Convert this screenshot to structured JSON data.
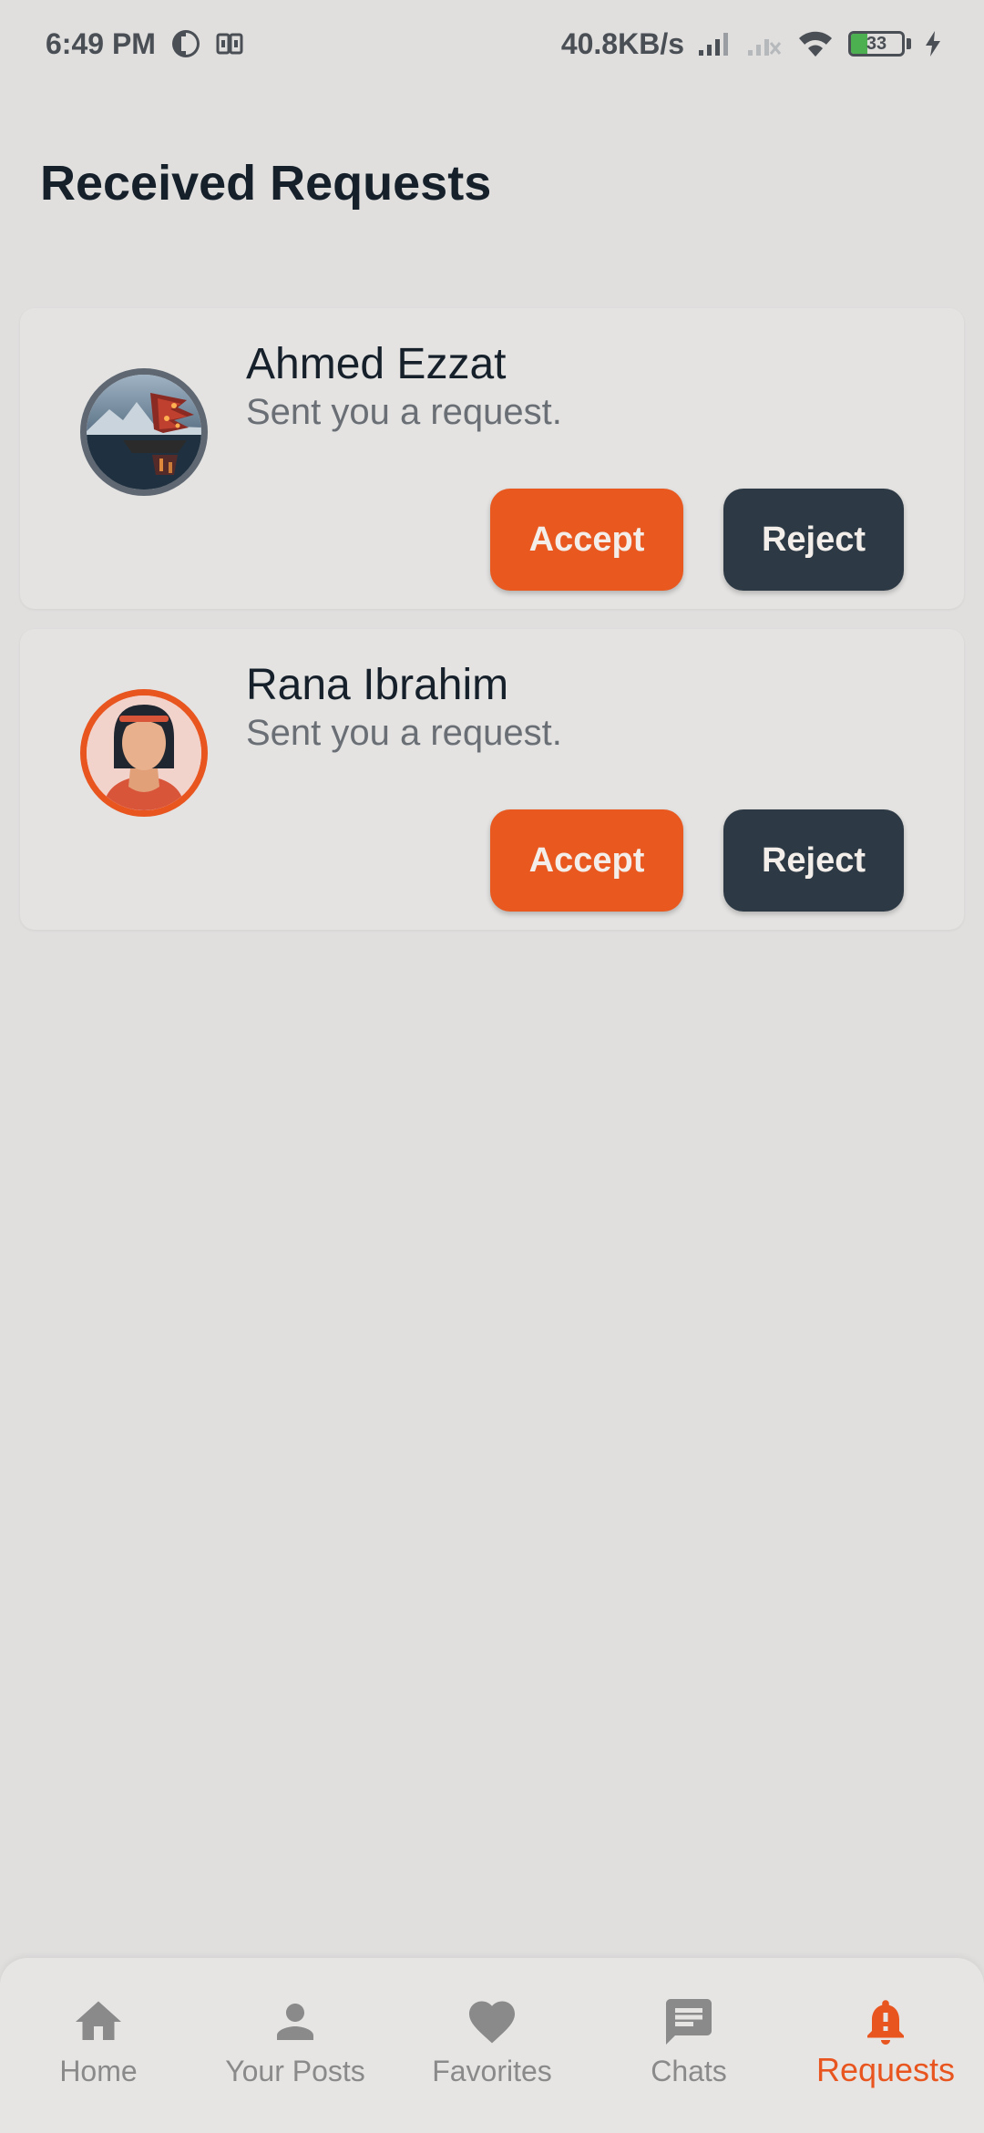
{
  "status_bar": {
    "time": "6:49 PM",
    "net_speed": "40.8KB/s",
    "battery_level": "33",
    "battery_fraction": 0.33,
    "icons": [
      "app-indicator-icon",
      "dual-sim-icon",
      "signal-icon",
      "no-signal-icon",
      "wifi-icon",
      "battery-icon",
      "charging-icon"
    ]
  },
  "page": {
    "title": "Received Requests"
  },
  "requests": [
    {
      "name": "Ahmed Ezzat",
      "subtitle": "Sent you a request.",
      "accept_label": "Accept",
      "reject_label": "Reject"
    },
    {
      "name": "Rana Ibrahim",
      "subtitle": "Sent you a request.",
      "accept_label": "Accept",
      "reject_label": "Reject"
    }
  ],
  "bottom_nav": {
    "items": [
      {
        "label": "Home",
        "icon": "home-icon"
      },
      {
        "label": "Your Posts",
        "icon": "person-icon"
      },
      {
        "label": "Favorites",
        "icon": "heart-icon"
      },
      {
        "label": "Chats",
        "icon": "chat-icon"
      },
      {
        "label": "Requests",
        "icon": "bell-icon",
        "active": true
      }
    ]
  },
  "colors": {
    "accent": "#e8551f",
    "dark_button": "#2d3a45",
    "background": "#e0dfde",
    "inactive_nav": "#8a8a8a"
  }
}
